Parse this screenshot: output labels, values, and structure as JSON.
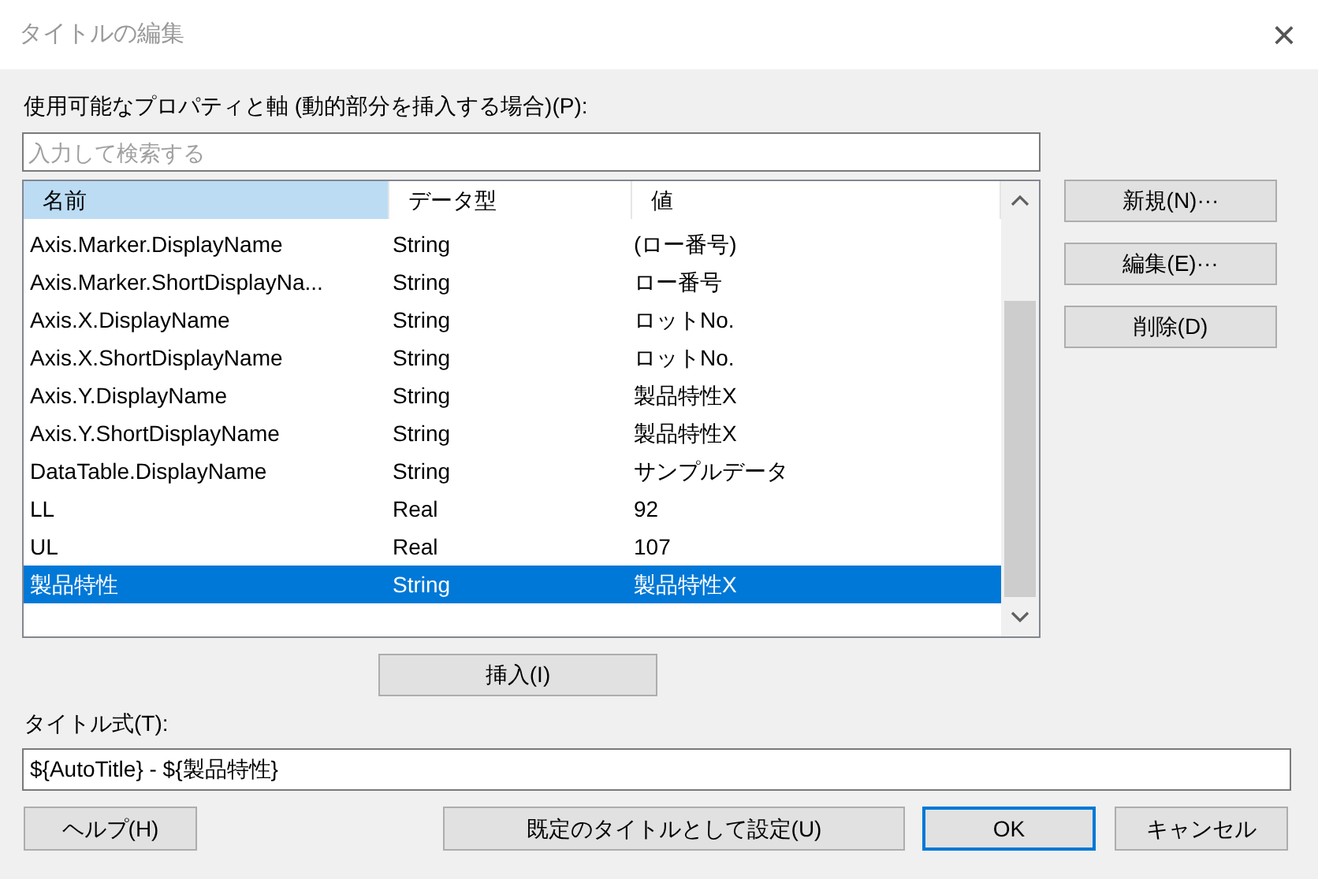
{
  "window": {
    "title": "タイトルの編集",
    "close": "×"
  },
  "properties_label": "使用可能なプロパティと軸 (動的部分を挿入する場合)(P):",
  "search": {
    "placeholder": "入力して検索する"
  },
  "table": {
    "columns": [
      {
        "label": "名前",
        "selected": true
      },
      {
        "label": "データ型",
        "selected": false
      },
      {
        "label": "値",
        "selected": false
      }
    ],
    "rows": [
      {
        "name": "Axis.Marker.DisplayName",
        "type": "String",
        "value": "(ロー番号)",
        "selected": false
      },
      {
        "name": "Axis.Marker.ShortDisplayNa...",
        "type": "String",
        "value": "ロー番号",
        "selected": false
      },
      {
        "name": "Axis.X.DisplayName",
        "type": "String",
        "value": "ロットNo.",
        "selected": false
      },
      {
        "name": "Axis.X.ShortDisplayName",
        "type": "String",
        "value": "ロットNo.",
        "selected": false
      },
      {
        "name": "Axis.Y.DisplayName",
        "type": "String",
        "value": "製品特性X",
        "selected": false
      },
      {
        "name": "Axis.Y.ShortDisplayName",
        "type": "String",
        "value": "製品特性X",
        "selected": false
      },
      {
        "name": "DataTable.DisplayName",
        "type": "String",
        "value": "サンプルデータ",
        "selected": false
      },
      {
        "name": "LL",
        "type": "Real",
        "value": "92",
        "selected": false
      },
      {
        "name": "UL",
        "type": "Real",
        "value": "107",
        "selected": false
      },
      {
        "name": "製品特性",
        "type": "String",
        "value": "製品特性X",
        "selected": true
      }
    ]
  },
  "side_buttons": [
    "新規(N)···",
    "編集(E)···",
    "削除(D)"
  ],
  "insert_button": "挿入(I)",
  "expression_label": "タイトル式(T):",
  "expression": {
    "value": "${AutoTitle} - ${製品特性}"
  },
  "footer_buttons": [
    {
      "label": "ヘルプ(H)",
      "default": false
    },
    {
      "label": "既定のタイトルとして設定(U)",
      "default": false
    },
    {
      "label": "OK",
      "default": true
    },
    {
      "label": "キャンセル",
      "default": false
    }
  ]
}
